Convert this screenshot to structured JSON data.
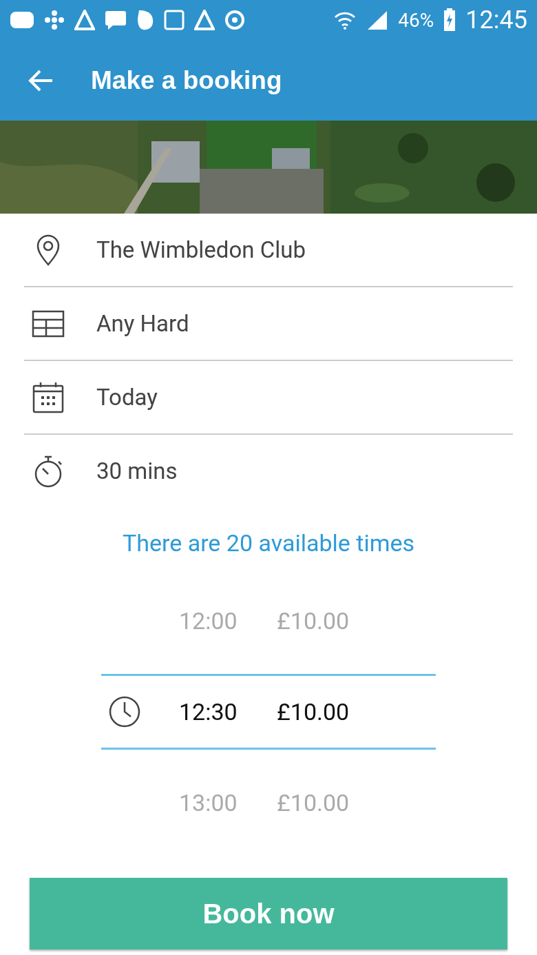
{
  "status_bar": {
    "battery": "46%",
    "time": "12:45"
  },
  "toolbar": {
    "title": "Make a booking"
  },
  "fields": [
    {
      "kind": "location",
      "value": "The Wimbledon Club"
    },
    {
      "kind": "court",
      "value": "Any Hard"
    },
    {
      "kind": "date",
      "value": "Today"
    },
    {
      "kind": "duration",
      "value": "30 mins"
    }
  ],
  "availability": "There are 20 available times",
  "times": [
    {
      "time": "12:00",
      "price": "£10.00",
      "selected": false
    },
    {
      "time": "12:30",
      "price": "£10.00",
      "selected": true
    },
    {
      "time": "13:00",
      "price": "£10.00",
      "selected": false
    }
  ],
  "book_button": "Book now"
}
